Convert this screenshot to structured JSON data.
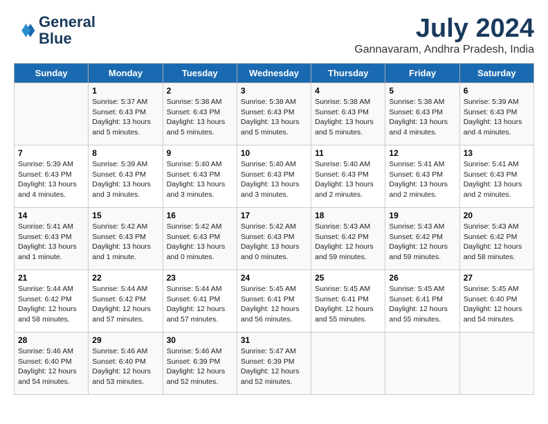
{
  "header": {
    "logo_line1": "General",
    "logo_line2": "Blue",
    "month_year": "July 2024",
    "location": "Gannavaram, Andhra Pradesh, India"
  },
  "days_of_week": [
    "Sunday",
    "Monday",
    "Tuesday",
    "Wednesday",
    "Thursday",
    "Friday",
    "Saturday"
  ],
  "weeks": [
    [
      {
        "day": "",
        "info": ""
      },
      {
        "day": "1",
        "info": "Sunrise: 5:37 AM\nSunset: 6:43 PM\nDaylight: 13 hours\nand 5 minutes."
      },
      {
        "day": "2",
        "info": "Sunrise: 5:38 AM\nSunset: 6:43 PM\nDaylight: 13 hours\nand 5 minutes."
      },
      {
        "day": "3",
        "info": "Sunrise: 5:38 AM\nSunset: 6:43 PM\nDaylight: 13 hours\nand 5 minutes."
      },
      {
        "day": "4",
        "info": "Sunrise: 5:38 AM\nSunset: 6:43 PM\nDaylight: 13 hours\nand 5 minutes."
      },
      {
        "day": "5",
        "info": "Sunrise: 5:38 AM\nSunset: 6:43 PM\nDaylight: 13 hours\nand 4 minutes."
      },
      {
        "day": "6",
        "info": "Sunrise: 5:39 AM\nSunset: 6:43 PM\nDaylight: 13 hours\nand 4 minutes."
      }
    ],
    [
      {
        "day": "7",
        "info": "Sunrise: 5:39 AM\nSunset: 6:43 PM\nDaylight: 13 hours\nand 4 minutes."
      },
      {
        "day": "8",
        "info": "Sunrise: 5:39 AM\nSunset: 6:43 PM\nDaylight: 13 hours\nand 3 minutes."
      },
      {
        "day": "9",
        "info": "Sunrise: 5:40 AM\nSunset: 6:43 PM\nDaylight: 13 hours\nand 3 minutes."
      },
      {
        "day": "10",
        "info": "Sunrise: 5:40 AM\nSunset: 6:43 PM\nDaylight: 13 hours\nand 3 minutes."
      },
      {
        "day": "11",
        "info": "Sunrise: 5:40 AM\nSunset: 6:43 PM\nDaylight: 13 hours\nand 2 minutes."
      },
      {
        "day": "12",
        "info": "Sunrise: 5:41 AM\nSunset: 6:43 PM\nDaylight: 13 hours\nand 2 minutes."
      },
      {
        "day": "13",
        "info": "Sunrise: 5:41 AM\nSunset: 6:43 PM\nDaylight: 13 hours\nand 2 minutes."
      }
    ],
    [
      {
        "day": "14",
        "info": "Sunrise: 5:41 AM\nSunset: 6:43 PM\nDaylight: 13 hours\nand 1 minute."
      },
      {
        "day": "15",
        "info": "Sunrise: 5:42 AM\nSunset: 6:43 PM\nDaylight: 13 hours\nand 1 minute."
      },
      {
        "day": "16",
        "info": "Sunrise: 5:42 AM\nSunset: 6:43 PM\nDaylight: 13 hours\nand 0 minutes."
      },
      {
        "day": "17",
        "info": "Sunrise: 5:42 AM\nSunset: 6:43 PM\nDaylight: 13 hours\nand 0 minutes."
      },
      {
        "day": "18",
        "info": "Sunrise: 5:43 AM\nSunset: 6:42 PM\nDaylight: 12 hours\nand 59 minutes."
      },
      {
        "day": "19",
        "info": "Sunrise: 5:43 AM\nSunset: 6:42 PM\nDaylight: 12 hours\nand 59 minutes."
      },
      {
        "day": "20",
        "info": "Sunrise: 5:43 AM\nSunset: 6:42 PM\nDaylight: 12 hours\nand 58 minutes."
      }
    ],
    [
      {
        "day": "21",
        "info": "Sunrise: 5:44 AM\nSunset: 6:42 PM\nDaylight: 12 hours\nand 58 minutes."
      },
      {
        "day": "22",
        "info": "Sunrise: 5:44 AM\nSunset: 6:42 PM\nDaylight: 12 hours\nand 57 minutes."
      },
      {
        "day": "23",
        "info": "Sunrise: 5:44 AM\nSunset: 6:41 PM\nDaylight: 12 hours\nand 57 minutes."
      },
      {
        "day": "24",
        "info": "Sunrise: 5:45 AM\nSunset: 6:41 PM\nDaylight: 12 hours\nand 56 minutes."
      },
      {
        "day": "25",
        "info": "Sunrise: 5:45 AM\nSunset: 6:41 PM\nDaylight: 12 hours\nand 55 minutes."
      },
      {
        "day": "26",
        "info": "Sunrise: 5:45 AM\nSunset: 6:41 PM\nDaylight: 12 hours\nand 55 minutes."
      },
      {
        "day": "27",
        "info": "Sunrise: 5:45 AM\nSunset: 6:40 PM\nDaylight: 12 hours\nand 54 minutes."
      }
    ],
    [
      {
        "day": "28",
        "info": "Sunrise: 5:46 AM\nSunset: 6:40 PM\nDaylight: 12 hours\nand 54 minutes."
      },
      {
        "day": "29",
        "info": "Sunrise: 5:46 AM\nSunset: 6:40 PM\nDaylight: 12 hours\nand 53 minutes."
      },
      {
        "day": "30",
        "info": "Sunrise: 5:46 AM\nSunset: 6:39 PM\nDaylight: 12 hours\nand 52 minutes."
      },
      {
        "day": "31",
        "info": "Sunrise: 5:47 AM\nSunset: 6:39 PM\nDaylight: 12 hours\nand 52 minutes."
      },
      {
        "day": "",
        "info": ""
      },
      {
        "day": "",
        "info": ""
      },
      {
        "day": "",
        "info": ""
      }
    ]
  ]
}
